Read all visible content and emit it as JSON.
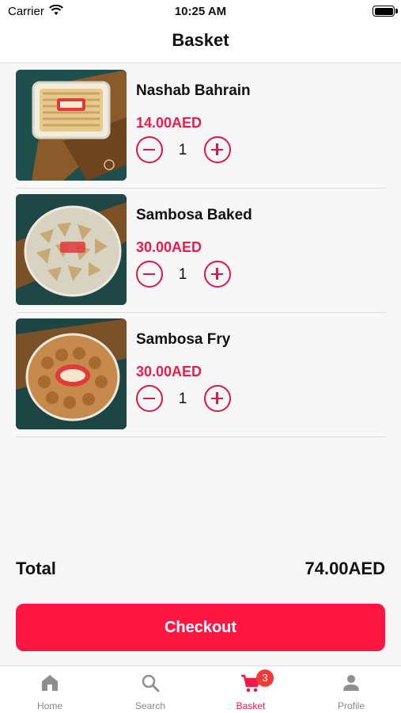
{
  "status_bar": {
    "carrier": "Carrier",
    "time": "10:25 AM"
  },
  "header": {
    "title": "Basket"
  },
  "basket": {
    "items": [
      {
        "name": "Nashab Bahrain",
        "price": "14.00AED",
        "quantity": "1"
      },
      {
        "name": "Sambosa Baked",
        "price": "30.00AED",
        "quantity": "1"
      },
      {
        "name": "Sambosa Fry",
        "price": "30.00AED",
        "quantity": "1"
      }
    ]
  },
  "summary": {
    "total_label": "Total",
    "total_value": "74.00AED"
  },
  "checkout": {
    "label": "Checkout"
  },
  "tabbar": {
    "tabs": [
      {
        "label": "Home",
        "icon": "home-icon"
      },
      {
        "label": "Search",
        "icon": "search-icon"
      },
      {
        "label": "Basket",
        "icon": "cart-icon",
        "badge": "3"
      },
      {
        "label": "Profile",
        "icon": "person-icon"
      }
    ],
    "active": "Basket"
  },
  "colors": {
    "accent": "#ff1744",
    "price": "#f0194a",
    "badge": "#f23a3a"
  }
}
